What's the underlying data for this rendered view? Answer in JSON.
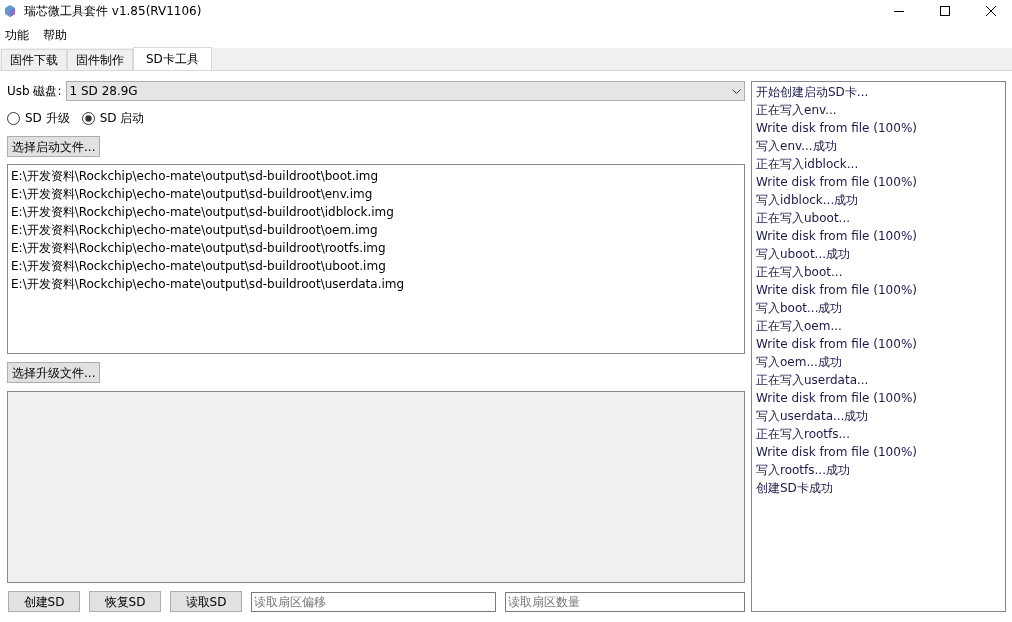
{
  "window": {
    "title": "瑞芯微工具套件 v1.85(RV1106)"
  },
  "menu": [
    "功能",
    "帮助"
  ],
  "tabs": [
    {
      "label": "固件下载",
      "selected": false
    },
    {
      "label": "固件制作",
      "selected": false
    },
    {
      "label": "SD卡工具",
      "selected": true
    }
  ],
  "usb_disk": {
    "label": "Usb 磁盘:",
    "value": "1 SD 28.9G"
  },
  "mode": [
    {
      "label": "SD 升级",
      "selected": false
    },
    {
      "label": "SD 启动",
      "selected": true
    }
  ],
  "select_boot_button": "选择启动文件...",
  "boot_files": [
    "E:\\开发资料\\Rockchip\\echo-mate\\output\\sd-buildroot\\boot.img",
    "E:\\开发资料\\Rockchip\\echo-mate\\output\\sd-buildroot\\env.img",
    "E:\\开发资料\\Rockchip\\echo-mate\\output\\sd-buildroot\\idblock.img",
    "E:\\开发资料\\Rockchip\\echo-mate\\output\\sd-buildroot\\oem.img",
    "E:\\开发资料\\Rockchip\\echo-mate\\output\\sd-buildroot\\rootfs.img",
    "E:\\开发资料\\Rockchip\\echo-mate\\output\\sd-buildroot\\uboot.img",
    "E:\\开发资料\\Rockchip\\echo-mate\\output\\sd-buildroot\\userdata.img"
  ],
  "select_upgrade_button": "选择升级文件...",
  "bottom_buttons": [
    "创建SD",
    "恢复SD",
    "读取SD"
  ],
  "sector_offset": {
    "placeholder": "读取扇区偏移"
  },
  "sector_count": {
    "placeholder": "读取扇区数量"
  },
  "log": [
    "开始创建启动SD卡...",
    "正在写入env...",
    "Write disk from file (100%)",
    "写入env...成功",
    "正在写入idblock...",
    "Write disk from file (100%)",
    "写入idblock...成功",
    "正在写入uboot...",
    "Write disk from file (100%)",
    "写入uboot...成功",
    "正在写入boot...",
    "Write disk from file (100%)",
    "写入boot...成功",
    "正在写入oem...",
    "Write disk from file (100%)",
    "写入oem...成功",
    "正在写入userdata...",
    "Write disk from file (100%)",
    "写入userdata...成功",
    "正在写入rootfs...",
    "Write disk from file (100%)",
    "写入rootfs...成功",
    "创建SD卡成功"
  ]
}
